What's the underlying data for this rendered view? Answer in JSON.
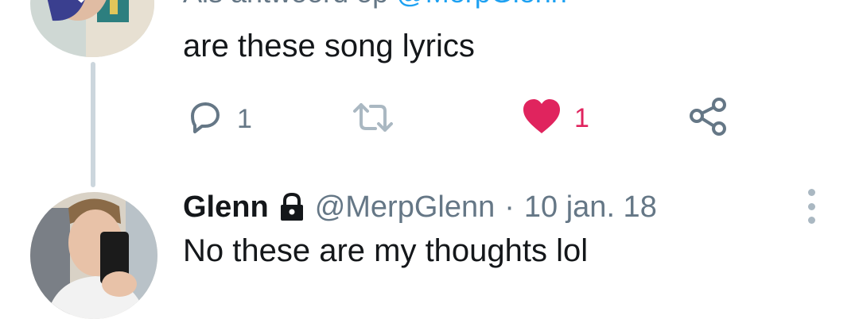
{
  "reply_context": {
    "prefix": "Als antwoord op",
    "mention": "@MerpGlenn"
  },
  "tweet1": {
    "text": "are these song lyrics",
    "reply_count": "1",
    "retweet_count": "",
    "like_count": "1",
    "liked": true
  },
  "tweet2": {
    "name": "Glenn",
    "handle": "@MerpGlenn",
    "separator": "·",
    "date": "10 jan. 18",
    "text": "No these are my thoughts lol"
  },
  "colors": {
    "text": "#14171a",
    "secondary": "#657786",
    "link": "#1da1f2",
    "like": "#e0245e",
    "thread_line": "#ccd6dd"
  },
  "icons": [
    "reply-icon",
    "retweet-icon",
    "heart-icon",
    "share-icon",
    "lock-icon",
    "more-icon"
  ]
}
